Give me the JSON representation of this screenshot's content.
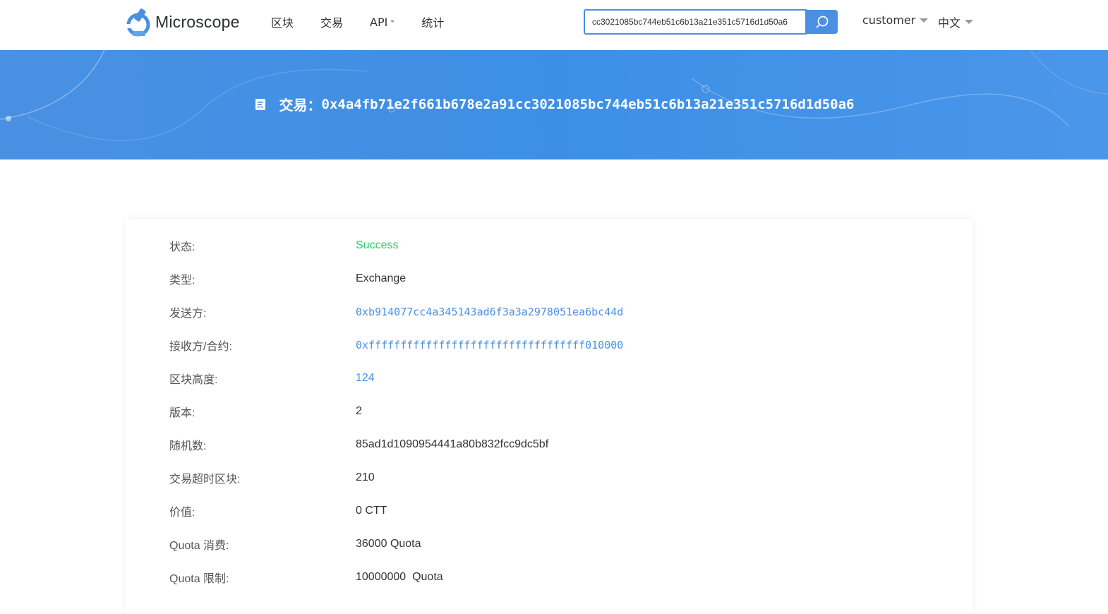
{
  "brand": {
    "name": "Microscope"
  },
  "nav": {
    "items": [
      {
        "label": "区块"
      },
      {
        "label": "交易"
      },
      {
        "label": "API"
      },
      {
        "label": "统计"
      }
    ]
  },
  "search": {
    "value": "cc3021085bc744eb51c6b13a21e351c5716d1d50a6",
    "icon": "search-icon"
  },
  "user_menu": {
    "label": "customer"
  },
  "lang_menu": {
    "label": "中文"
  },
  "banner": {
    "prefix": "交易：",
    "hash": "0x4a4fb71e2f661b678e2a91cc3021085bc744eb51c6b13a21e351c5716d1d50a6",
    "icon": "document-icon"
  },
  "details": [
    {
      "label": "状态:",
      "value": "Success"
    },
    {
      "label": "类型:",
      "value": "Exchange"
    },
    {
      "label": "发送方:",
      "value": "0xb914077cc4a345143ad6f3a3a2978051ea6bc44d"
    },
    {
      "label": "接收方/合约:",
      "value": "0xffffffffffffffffffffffffffffffffff010000"
    },
    {
      "label": "区块高度:",
      "value": "124"
    },
    {
      "label": "版本:",
      "value": "2"
    },
    {
      "label": "随机数:",
      "value": "85ad1d1090954441a80b832fcc9dc5bf"
    },
    {
      "label": "交易超时区块:",
      "value": "210"
    },
    {
      "label": "价值:",
      "value": "0 CTT"
    },
    {
      "label": "Quota 消费:",
      "value": "36000 Quota"
    },
    {
      "label": "Quota 限制:",
      "value": "10000000  Quota"
    }
  ],
  "colors": {
    "accent": "#4a90e2",
    "success": "#2ecc71",
    "banner": "#3d8fe6"
  }
}
